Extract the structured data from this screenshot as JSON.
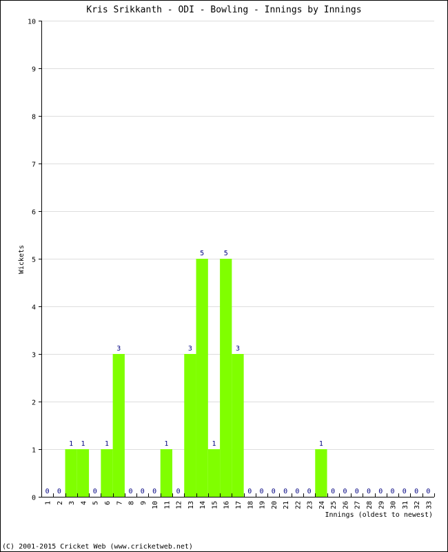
{
  "chart_data": {
    "type": "bar",
    "title": "Kris Srikkanth - ODI - Bowling - Innings by Innings",
    "xlabel": "Innings (oldest to newest)",
    "ylabel": "Wickets",
    "ylim": [
      0,
      10
    ],
    "yticks": [
      0,
      1,
      2,
      3,
      4,
      5,
      6,
      7,
      8,
      9,
      10
    ],
    "grid": true,
    "categories": [
      "1",
      "2",
      "3",
      "4",
      "5",
      "6",
      "7",
      "8",
      "9",
      "10",
      "11",
      "12",
      "13",
      "14",
      "15",
      "16",
      "17",
      "18",
      "19",
      "20",
      "21",
      "22",
      "23",
      "24",
      "25",
      "26",
      "27",
      "28",
      "29",
      "30",
      "31",
      "32",
      "33"
    ],
    "values": [
      0,
      0,
      1,
      1,
      0,
      1,
      3,
      0,
      0,
      0,
      1,
      0,
      3,
      5,
      1,
      5,
      3,
      0,
      0,
      0,
      0,
      0,
      0,
      1,
      0,
      0,
      0,
      0,
      0,
      0,
      0,
      0,
      0
    ],
    "bar_color": "#80ff00",
    "label_color": "#000080"
  },
  "footer": "(C) 2001-2015 Cricket Web (www.cricketweb.net)"
}
